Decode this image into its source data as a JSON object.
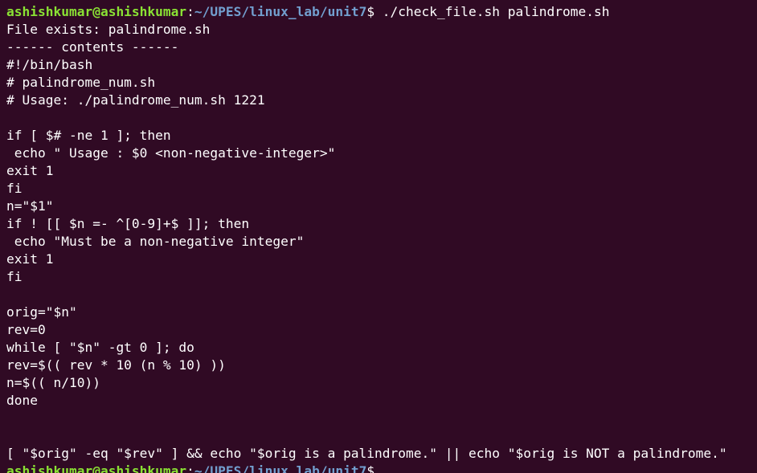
{
  "terminal": {
    "background": "#300a24",
    "user_color": "#8ae234",
    "path_color": "#729fcf",
    "text_color": "#ffffff",
    "prompt": {
      "user_host": "ashishkumar@ashishkumar",
      "separator": ":",
      "path": "~/UPES/linux_lab/unit7",
      "symbol": "$"
    },
    "command": " ./check_file.sh palindrome.sh",
    "output_lines": [
      "File exists: palindrome.sh",
      "------ contents ------",
      "#!/bin/bash",
      "# palindrome_num.sh",
      "# Usage: ./palindrome_num.sh 1221",
      "",
      "if [ $# -ne 1 ]; then",
      " echo \" Usage : $0 <non-negative-integer>\"",
      "exit 1",
      "fi",
      "n=\"$1\"",
      "if ! [[ $n =- ^[0-9]+$ ]]; then",
      " echo \"Must be a non-negative integer\"",
      "exit 1",
      "fi",
      "",
      "orig=\"$n\"",
      "rev=0",
      "while [ \"$n\" -gt 0 ]; do",
      "rev=$(( rev * 10 (n % 10) ))",
      "n=$(( n/10))",
      "done",
      "",
      "",
      "[ \"$orig\" -eq \"$rev\" ] && echo \"$orig is a palindrome.\" || echo \"$orig is NOT a palindrome.\""
    ]
  }
}
